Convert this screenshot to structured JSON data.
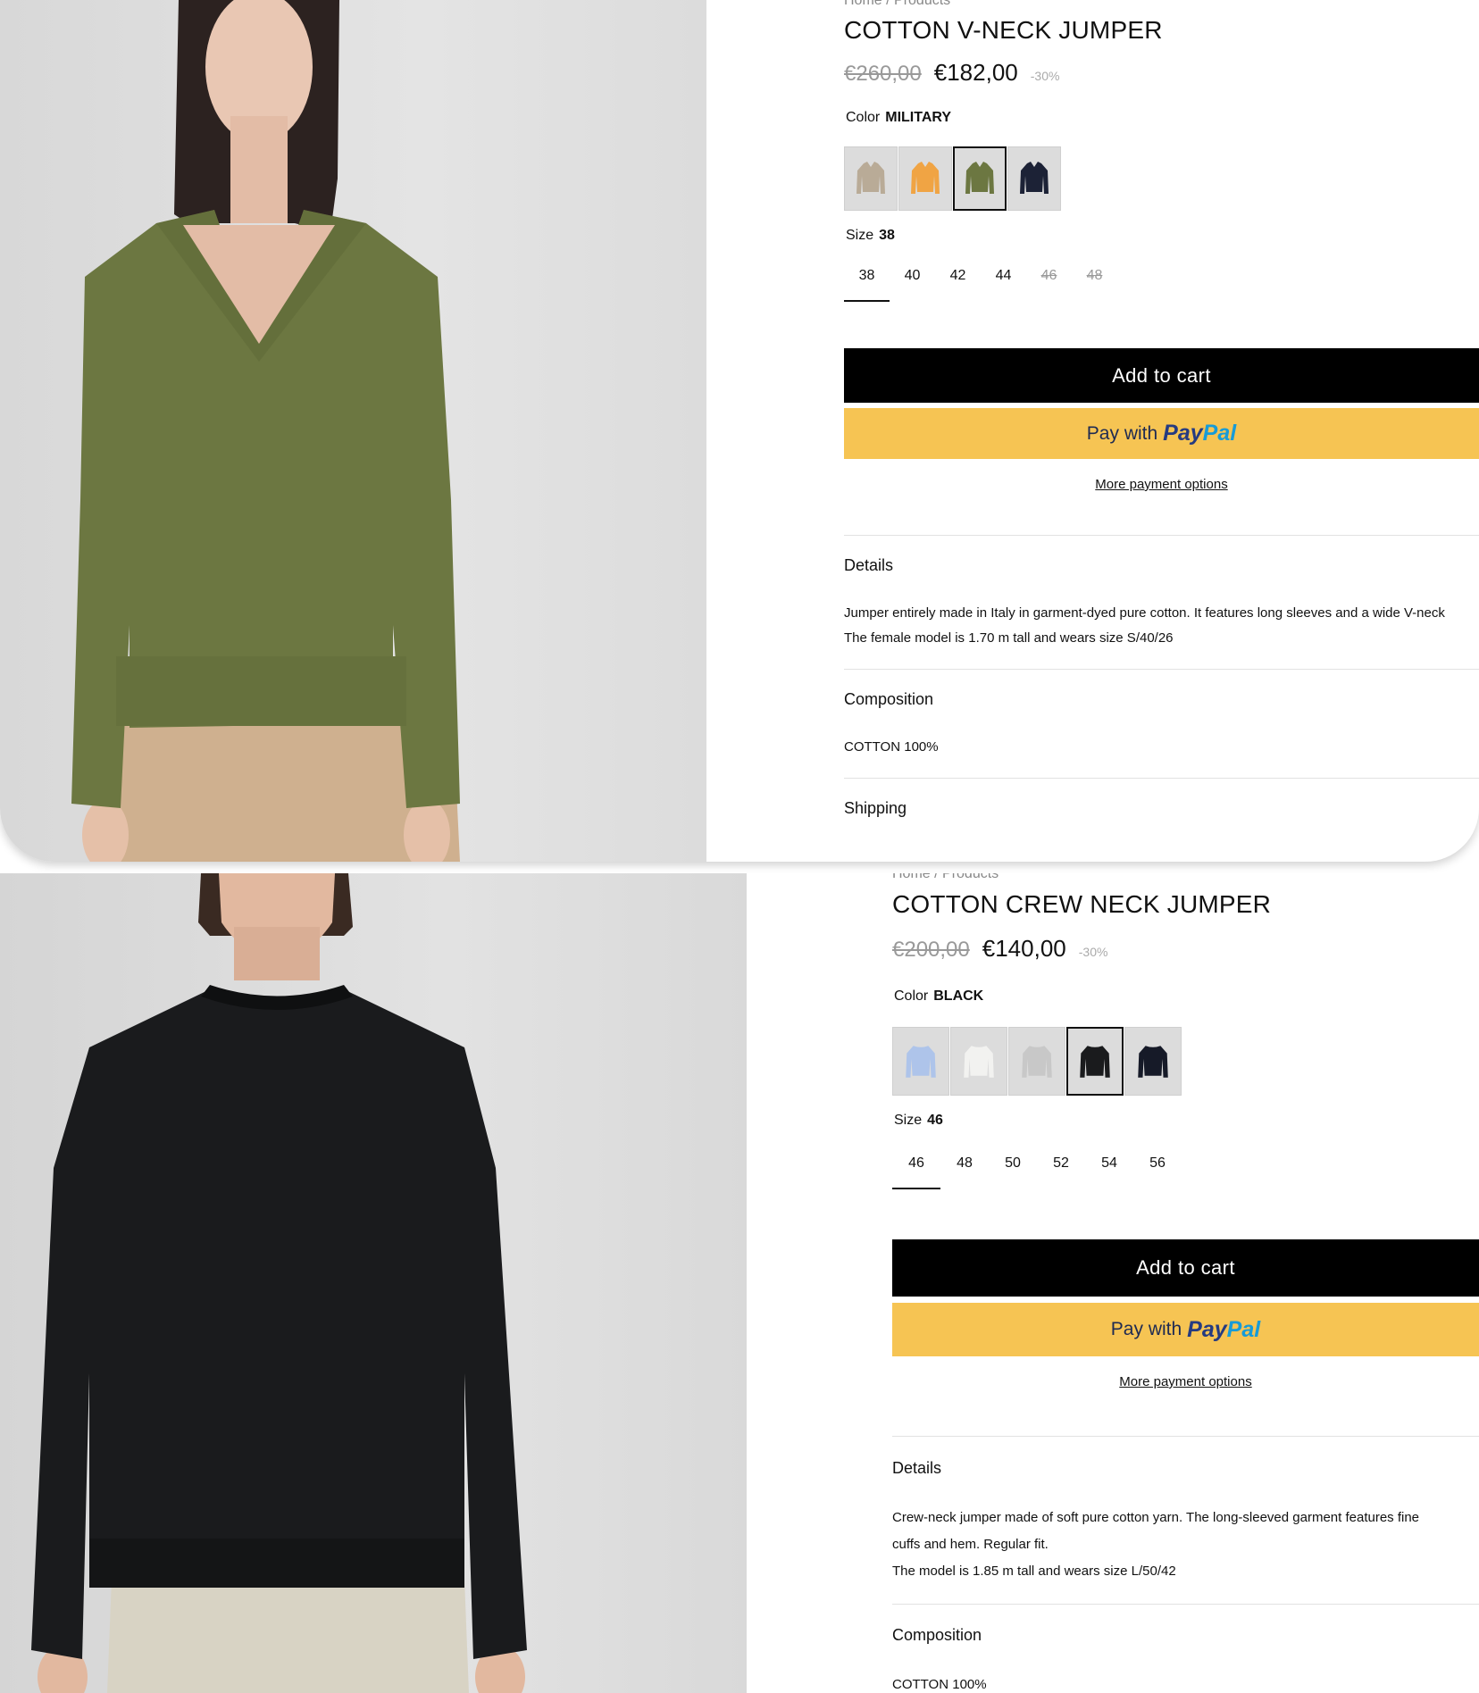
{
  "products": [
    {
      "breadcrumb": "Home / Products",
      "title": "COTTON V-NECK JUMPER",
      "price_old": "€260,00",
      "price_now": "€182,00",
      "discount": "-30%",
      "color_label": "Color",
      "color_value": "MILITARY",
      "swatches": [
        "beige",
        "orange",
        "military",
        "navy"
      ],
      "selected_swatch": 2,
      "size_label": "Size",
      "size_value": "38",
      "sizes": [
        "38",
        "40",
        "42",
        "44",
        "46",
        "48"
      ],
      "sizes_unavailable": [
        "46",
        "48"
      ],
      "add_to_cart": "Add to cart",
      "pay_with": "Pay with",
      "paypal_pay": "Pay",
      "paypal_pal": "Pal",
      "more_payment": "More payment options",
      "details_heading": "Details",
      "details_lines": [
        "Jumper entirely made in Italy in garment-dyed pure cotton. It features long sleeves and a wide V-neck",
        "The female model is 1.70 m tall and wears size S/40/26"
      ],
      "composition_heading": "Composition",
      "composition_text": "COTTON 100%",
      "shipping_heading": "Shipping"
    },
    {
      "breadcrumb": "Home / Products",
      "title": "COTTON CREW NECK JUMPER",
      "price_old": "€200,00",
      "price_now": "€140,00",
      "discount": "-30%",
      "color_label": "Color",
      "color_value": "BLACK",
      "swatches": [
        "light-blue",
        "white",
        "light-grey",
        "black",
        "navy"
      ],
      "selected_swatch": 3,
      "size_label": "Size",
      "size_value": "46",
      "sizes": [
        "46",
        "48",
        "50",
        "52",
        "54",
        "56"
      ],
      "sizes_unavailable": [],
      "add_to_cart": "Add to cart",
      "pay_with": "Pay with",
      "paypal_pay": "Pay",
      "paypal_pal": "Pal",
      "more_payment": "More payment options",
      "details_heading": "Details",
      "details_lines": [
        "Crew-neck jumper made of soft pure cotton yarn. The long-sleeved garment features fine",
        "cuffs and hem. Regular fit.",
        "The model is 1.85 m tall and wears size L/50/42"
      ],
      "composition_heading": "Composition",
      "composition_text": "COTTON 100%"
    }
  ],
  "colors": {
    "beige": "#b9ab97",
    "orange": "#f0a444",
    "military": "#6c7741",
    "navy": "#1c2236",
    "light-blue": "#aec4ea",
    "white": "#f2f2f0",
    "light-grey": "#c8c8c8",
    "black": "#1a1b1d",
    "paypal_yellow": "#f6c453",
    "paypal_dark": "#253b80",
    "paypal_light": "#179bd7"
  }
}
